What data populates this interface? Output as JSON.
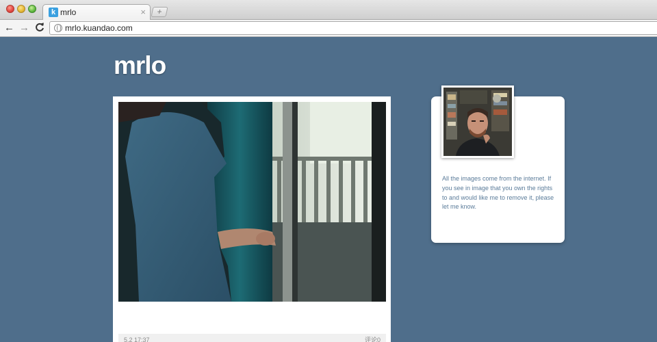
{
  "browser": {
    "tab": {
      "favicon_letter": "k",
      "title": "mrlo",
      "close_glyph": "×"
    },
    "new_tab_glyph": "+",
    "nav": {
      "back_glyph": "←",
      "forward_glyph": "→",
      "reload_glyph": "C"
    },
    "url": "mrlo.kuandao.com"
  },
  "blog": {
    "title": "mrlo"
  },
  "post": {
    "date": "5.2 17:37",
    "comments": "评论0"
  },
  "sidebar": {
    "description": "All the images come from the internet. If you see in image that you own the rights to and would like me to remove it, please let me know."
  },
  "colors": {
    "page_background": "#4f6e8b",
    "card_background": "#ffffff",
    "description_text": "#5a7b99"
  },
  "icons": [
    "close-traffic-icon",
    "minimize-traffic-icon",
    "zoom-traffic-icon",
    "favicon-icon",
    "tab-close-icon",
    "new-tab-icon",
    "back-arrow-icon",
    "forward-arrow-icon",
    "reload-icon",
    "globe-icon"
  ]
}
